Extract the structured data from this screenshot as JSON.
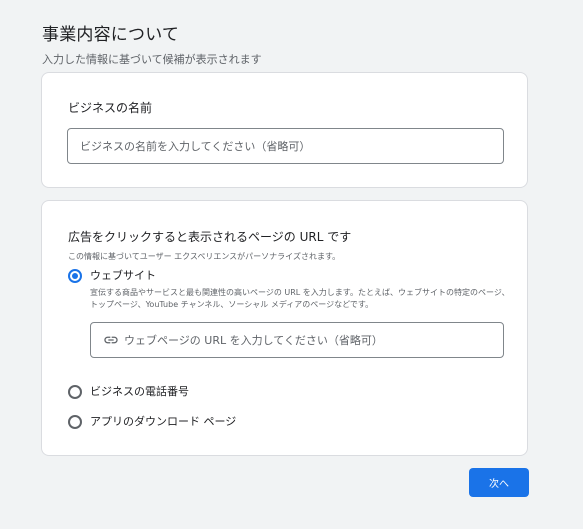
{
  "header": {
    "title": "事業内容について",
    "subtitle": "入力した情報に基づいて候補が表示されます"
  },
  "business_name_card": {
    "label": "ビジネスの名前",
    "placeholder": "ビジネスの名前を入力してください（省略可）"
  },
  "destination_card": {
    "title": "広告をクリックすると表示されるページの URL です",
    "description": "この情報に基づいてユーザー エクスペリエンスがパーソナライズされます。",
    "options": [
      {
        "label": "ウェブサイト",
        "selected": true,
        "description": "宣伝する商品やサービスと最も関連性の高いページの URL を入力します。たとえば、ウェブサイトの特定のページ、トップページ、YouTube チャンネル、ソーシャル メディアのページなどです。",
        "input_placeholder": "ウェブページの URL を入力してください（省略可）",
        "input_icon": "link-icon"
      },
      {
        "label": "ビジネスの電話番号",
        "selected": false
      },
      {
        "label": "アプリのダウンロード ページ",
        "selected": false
      }
    ]
  },
  "footer": {
    "next_label": "次へ"
  },
  "colors": {
    "accent": "#1a73e8",
    "background": "#f1f3f4",
    "card": "#ffffff",
    "border": "#dadce0"
  }
}
